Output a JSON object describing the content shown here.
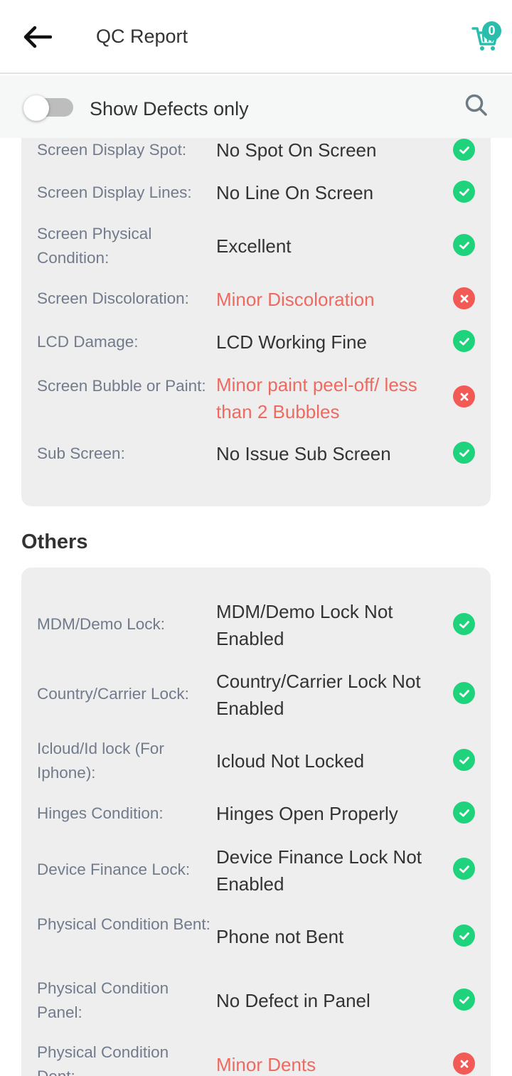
{
  "header": {
    "title": "QC Report",
    "cart_count": "0"
  },
  "filter": {
    "label": "Show Defects only",
    "toggle_on": false
  },
  "colors": {
    "accent": "#2bbdab",
    "ok": "#1fd27c",
    "defect": "#f25a55",
    "defect_text": "#ee6a60"
  },
  "screen_section": {
    "items": [
      {
        "label": "Screen Display Spot:",
        "value": "No Spot On Screen",
        "status": "ok"
      },
      {
        "label": "Screen Display Lines:",
        "value": "No Line On Screen",
        "status": "ok"
      },
      {
        "label": "Screen Physical Condition:",
        "value": "Excellent",
        "status": "ok"
      },
      {
        "label": "Screen Discoloration:",
        "value": "Minor Discoloration",
        "status": "defect"
      },
      {
        "label": "LCD Damage:",
        "value": "LCD Working Fine",
        "status": "ok"
      },
      {
        "label": "Screen Bubble or Paint:",
        "value": "Minor paint peel-off/ less than 2 Bubbles",
        "status": "defect"
      },
      {
        "label": "Sub Screen:",
        "value": "No Issue Sub Screen",
        "status": "ok"
      }
    ]
  },
  "others_section": {
    "title": "Others",
    "items": [
      {
        "label": "MDM/Demo Lock:",
        "value": "MDM/Demo Lock Not Enabled",
        "status": "ok"
      },
      {
        "label": "Country/Carrier Lock:",
        "value": "Country/Carrier Lock Not Enabled",
        "status": "ok"
      },
      {
        "label": "Icloud/Id lock (For Iphone):",
        "value": "Icloud Not Locked",
        "status": "ok"
      },
      {
        "label": "Hinges Condition:",
        "value": "Hinges Open Properly",
        "status": "ok"
      },
      {
        "label": "Device Finance Lock:",
        "value": "Device Finance Lock Not Enabled",
        "status": "ok"
      },
      {
        "label": "Physical Condition Bent:",
        "value": "Phone not Bent",
        "status": "ok"
      },
      {
        "label": "Physical Condition Panel:",
        "value": "No Defect in Panel",
        "status": "ok"
      },
      {
        "label": "Physical Condition Dent:",
        "value": "Minor Dents",
        "status": "defect"
      }
    ]
  }
}
